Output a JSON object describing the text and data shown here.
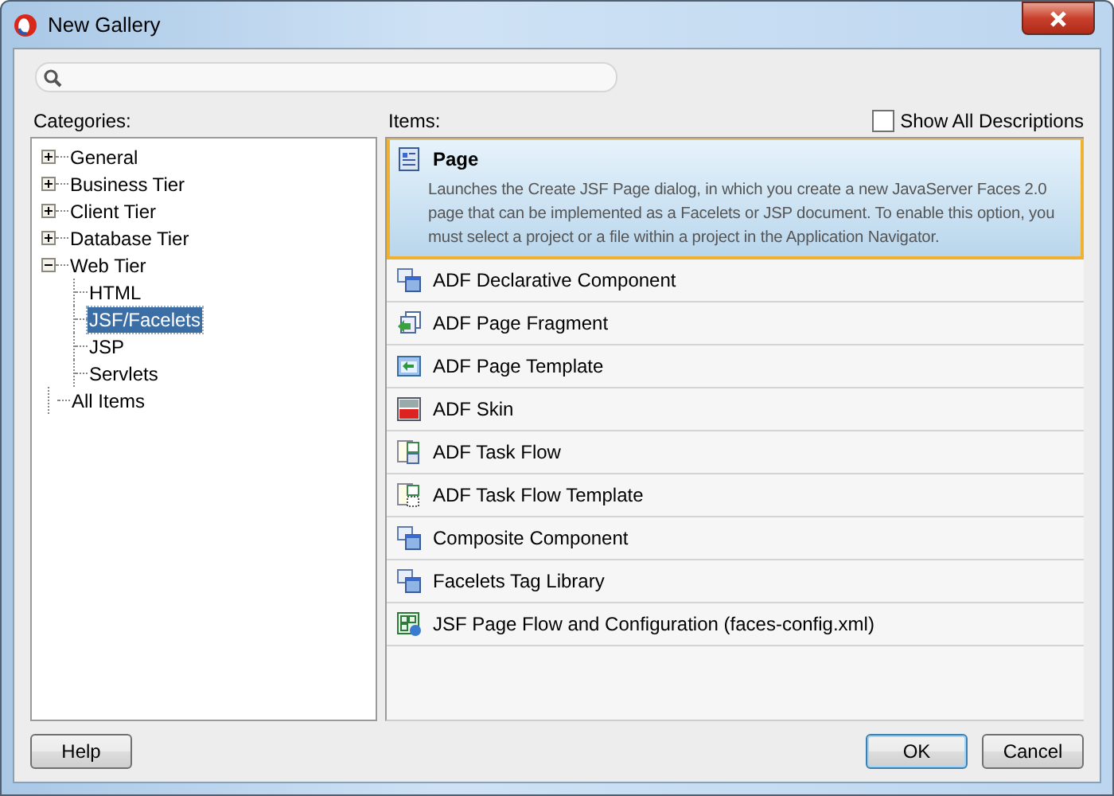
{
  "window": {
    "title": "New Gallery"
  },
  "categories": {
    "label": "Categories:",
    "tree": [
      {
        "label": "General",
        "expanded": false,
        "selected": false
      },
      {
        "label": "Business Tier",
        "expanded": false,
        "selected": false
      },
      {
        "label": "Client Tier",
        "expanded": false,
        "selected": false
      },
      {
        "label": "Database Tier",
        "expanded": false,
        "selected": false
      },
      {
        "label": "Web Tier",
        "expanded": true,
        "selected": false,
        "children": [
          {
            "label": "HTML",
            "selected": false
          },
          {
            "label": "JSF/Facelets",
            "selected": true
          },
          {
            "label": "JSP",
            "selected": false
          },
          {
            "label": "Servlets",
            "selected": false
          }
        ]
      },
      {
        "label": "All Items",
        "selected": false
      }
    ]
  },
  "items": {
    "label": "Items:",
    "show_all_descriptions": {
      "label": "Show All Descriptions",
      "checked": false
    },
    "list": [
      {
        "label": "Page",
        "selected": true,
        "description": "Launches the Create JSF Page dialog, in which you create a new JavaServer Faces 2.0 page that can be implemented as a Facelets or JSP document. To enable this option, you must select a project or a file within a project in the Application Navigator."
      },
      {
        "label": "ADF Declarative Component",
        "selected": false
      },
      {
        "label": "ADF Page Fragment",
        "selected": false
      },
      {
        "label": "ADF Page Template",
        "selected": false
      },
      {
        "label": "ADF Skin",
        "selected": false
      },
      {
        "label": "ADF Task Flow",
        "selected": false
      },
      {
        "label": "ADF Task Flow Template",
        "selected": false
      },
      {
        "label": "Composite Component",
        "selected": false
      },
      {
        "label": "Facelets Tag Library",
        "selected": false
      },
      {
        "label": "JSF Page Flow and Configuration (faces-config.xml)",
        "selected": false
      }
    ]
  },
  "buttons": [
    {
      "label": "Help",
      "kind": "plain"
    },
    {
      "label": "OK",
      "kind": "default"
    },
    {
      "label": "Cancel",
      "kind": "plain"
    }
  ]
}
